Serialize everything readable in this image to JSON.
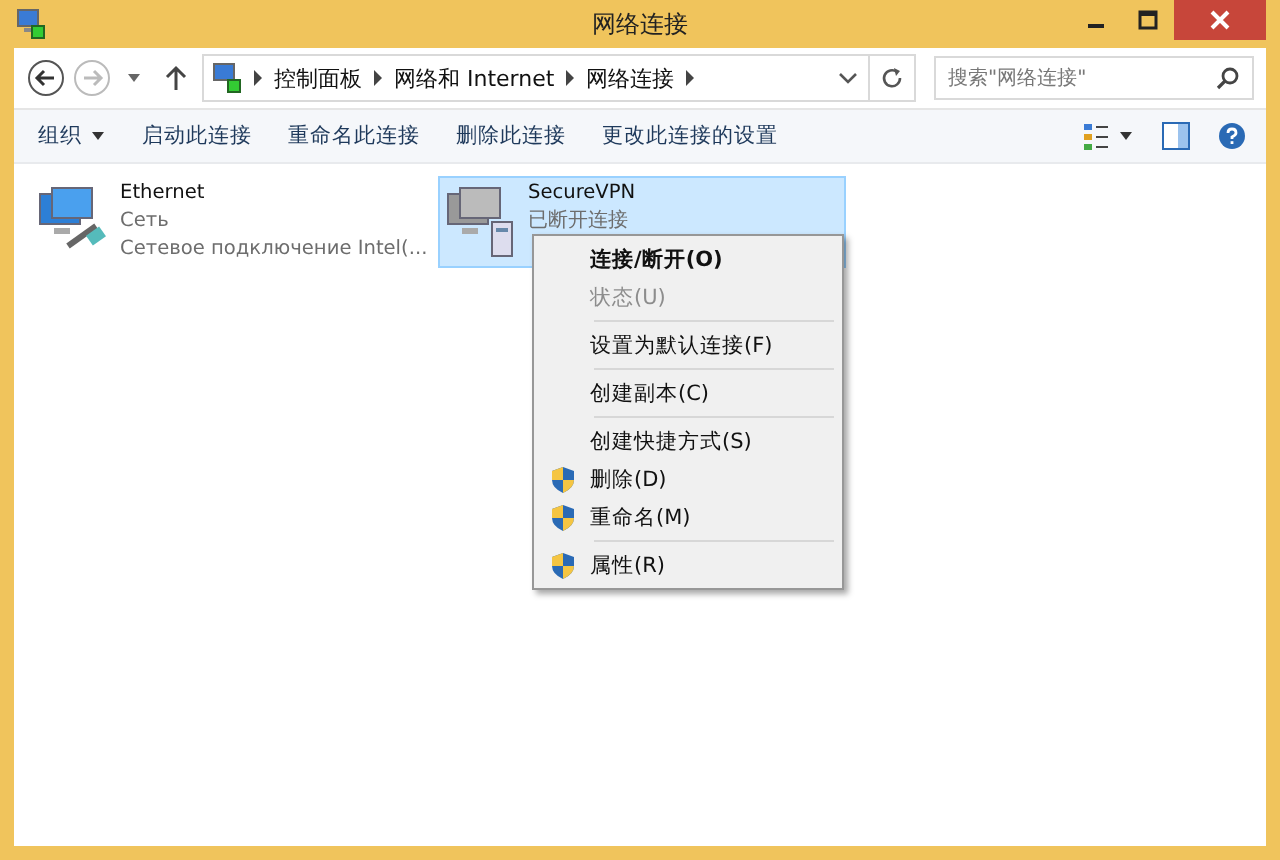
{
  "window": {
    "title": "网络连接"
  },
  "address": {
    "crumbs": [
      "控制面板",
      "网络和 Internet",
      "网络连接"
    ]
  },
  "search": {
    "placeholder": "搜索\"网络连接\""
  },
  "toolbar": {
    "organize": "组织",
    "commands": [
      "启动此连接",
      "重命名此连接",
      "删除此连接",
      "更改此连接的设置"
    ]
  },
  "connections": [
    {
      "kind": "ethernet",
      "name": "Ethernet",
      "status": "Сеть",
      "device": "Сетевое подключение Intel(...",
      "selected": false
    },
    {
      "kind": "vpn",
      "name": "SecureVPN",
      "status": "已断开连接",
      "selected": true
    }
  ],
  "context_menu": [
    {
      "kind": "item",
      "label": "连接/断开(O)",
      "default": true,
      "disabled": false,
      "shield": false
    },
    {
      "kind": "item",
      "label": "状态(U)",
      "default": false,
      "disabled": true,
      "shield": false
    },
    {
      "kind": "separator"
    },
    {
      "kind": "item",
      "label": "设置为默认连接(F)",
      "default": false,
      "disabled": false,
      "shield": false
    },
    {
      "kind": "separator"
    },
    {
      "kind": "item",
      "label": "创建副本(C)",
      "default": false,
      "disabled": false,
      "shield": false
    },
    {
      "kind": "separator"
    },
    {
      "kind": "item",
      "label": "创建快捷方式(S)",
      "default": false,
      "disabled": false,
      "shield": false
    },
    {
      "kind": "item",
      "label": "删除(D)",
      "default": false,
      "disabled": false,
      "shield": true
    },
    {
      "kind": "item",
      "label": "重命名(M)",
      "default": false,
      "disabled": false,
      "shield": true
    },
    {
      "kind": "separator"
    },
    {
      "kind": "item",
      "label": "属性(R)",
      "default": false,
      "disabled": false,
      "shield": true
    }
  ]
}
